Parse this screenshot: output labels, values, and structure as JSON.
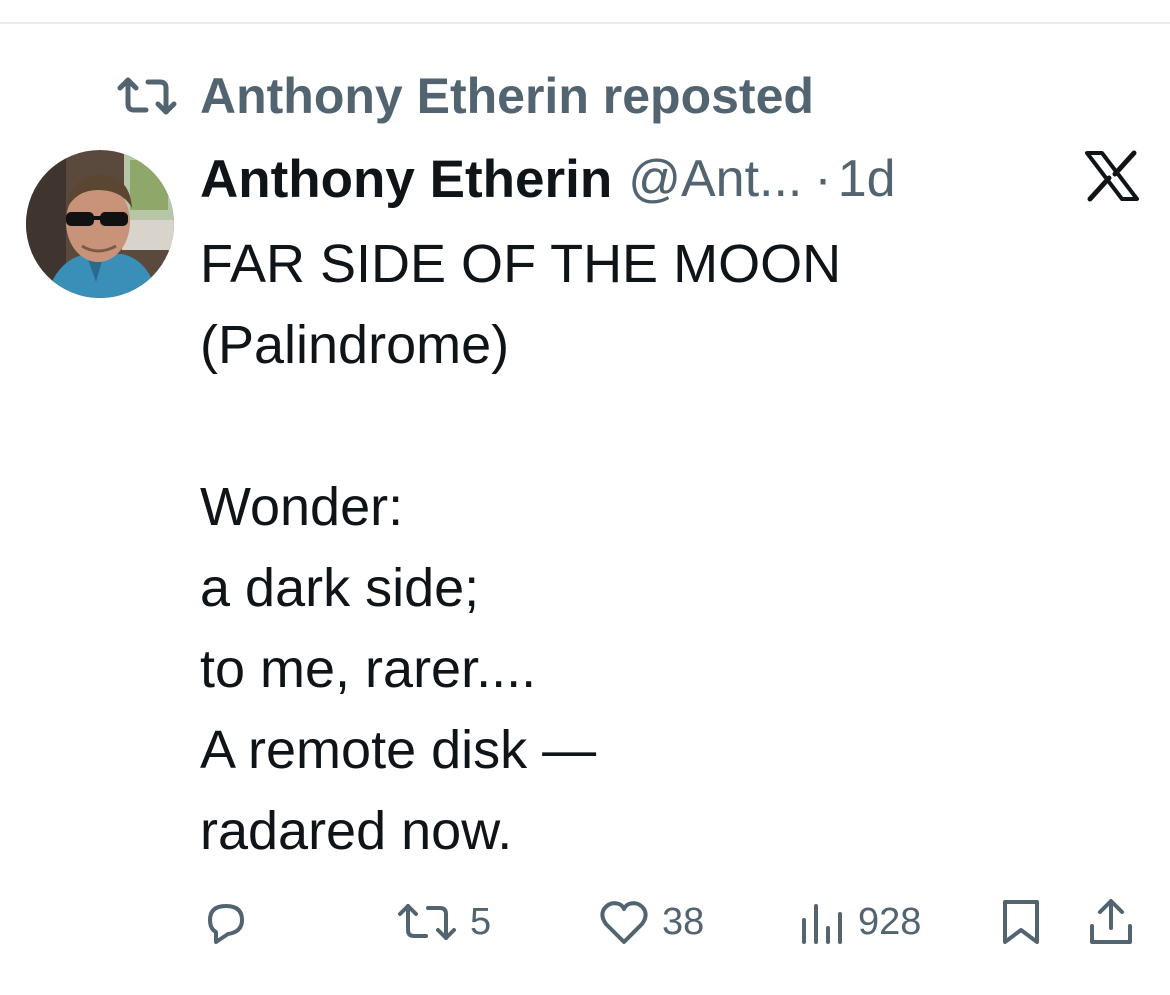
{
  "repost": {
    "text": "Anthony Etherin reposted",
    "icon": "repost-icon"
  },
  "post": {
    "author_name": "Anthony Etherin",
    "author_handle": "@Ant...",
    "separator": "·",
    "time": "1d",
    "platform_icon": "x-logo-icon",
    "avatar_icon": "avatar-photo",
    "lines": [
      "FAR SIDE OF THE MOON",
      "(Palindrome)",
      "",
      "Wonder:",
      "a dark side;",
      "to me, rarer....",
      "A remote disk —",
      "radared now."
    ]
  },
  "actions": {
    "reply": {
      "icon": "reply-icon",
      "count": ""
    },
    "repost": {
      "icon": "repost-icon",
      "count": "5"
    },
    "like": {
      "icon": "heart-icon",
      "count": "38"
    },
    "views": {
      "icon": "views-bar-chart-icon",
      "count": "928"
    },
    "bookmark": {
      "icon": "bookmark-icon"
    },
    "share": {
      "icon": "share-icon"
    }
  },
  "colors": {
    "primary_text": "#0f1419",
    "secondary_text": "#536471",
    "divider": "#e7e9ea",
    "background": "#ffffff"
  }
}
